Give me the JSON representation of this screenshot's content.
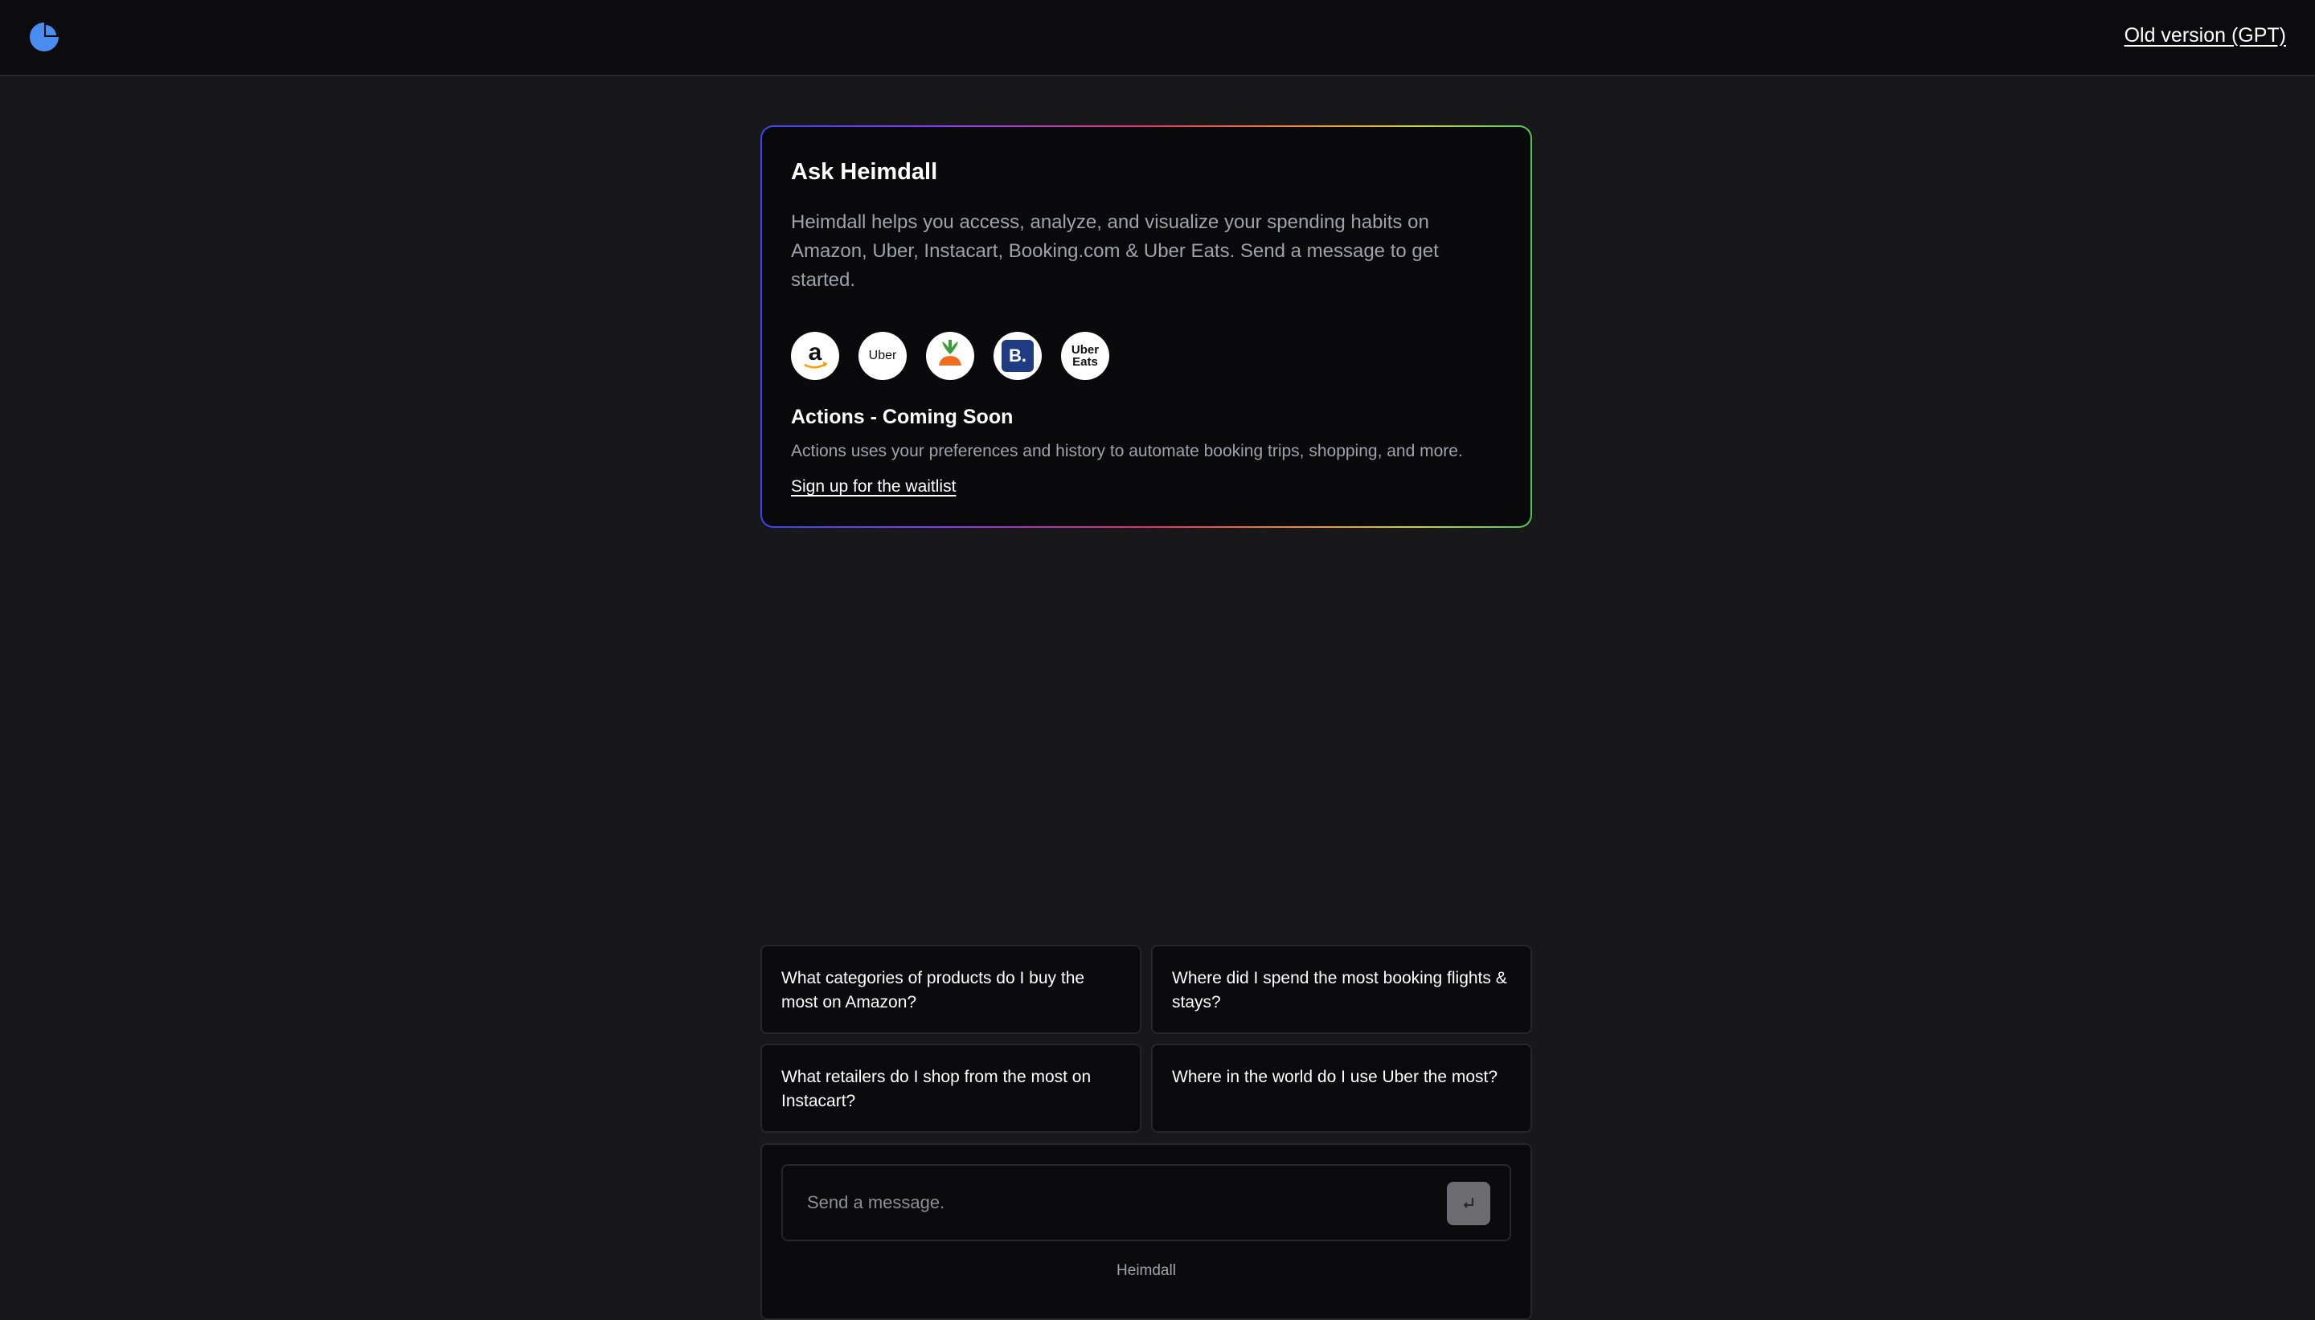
{
  "header": {
    "logo_icon": "pie-chart-logo-icon",
    "old_version_link": "Old version (GPT)"
  },
  "intro": {
    "title": "Ask Heimdall",
    "description": "Heimdall helps you access, analyze, and visualize your spending habits on Amazon, Uber, Instacart, Booking.com & Uber Eats. Send a message to get started.",
    "brands": [
      {
        "name": "amazon-logo-icon",
        "label": "a"
      },
      {
        "name": "uber-logo-icon",
        "label": "Uber"
      },
      {
        "name": "instacart-logo-icon",
        "label": ""
      },
      {
        "name": "booking-logo-icon",
        "label": "B."
      },
      {
        "name": "uber-eats-logo-icon",
        "label_line1": "Uber",
        "label_line2": "Eats"
      }
    ],
    "actions_title": "Actions - Coming Soon",
    "actions_desc": "Actions uses your preferences and history to automate booking trips, shopping, and more.",
    "waitlist_link": "Sign up for the waitlist"
  },
  "suggestions": [
    "What categories of products do I buy the most on Amazon?",
    "Where did I spend the most booking flights & stays?",
    "What retailers do I shop from the most on Instacart?",
    "Where in the world do I use Uber the most?"
  ],
  "composer": {
    "placeholder": "Send a message.",
    "send_icon": "enter-return-icon",
    "footer": "Heimdall"
  },
  "colors": {
    "background": "#18181b",
    "topbar": "#0c0c0e",
    "logo_blue": "#4a8df0",
    "booking_blue": "#1f3b82"
  }
}
